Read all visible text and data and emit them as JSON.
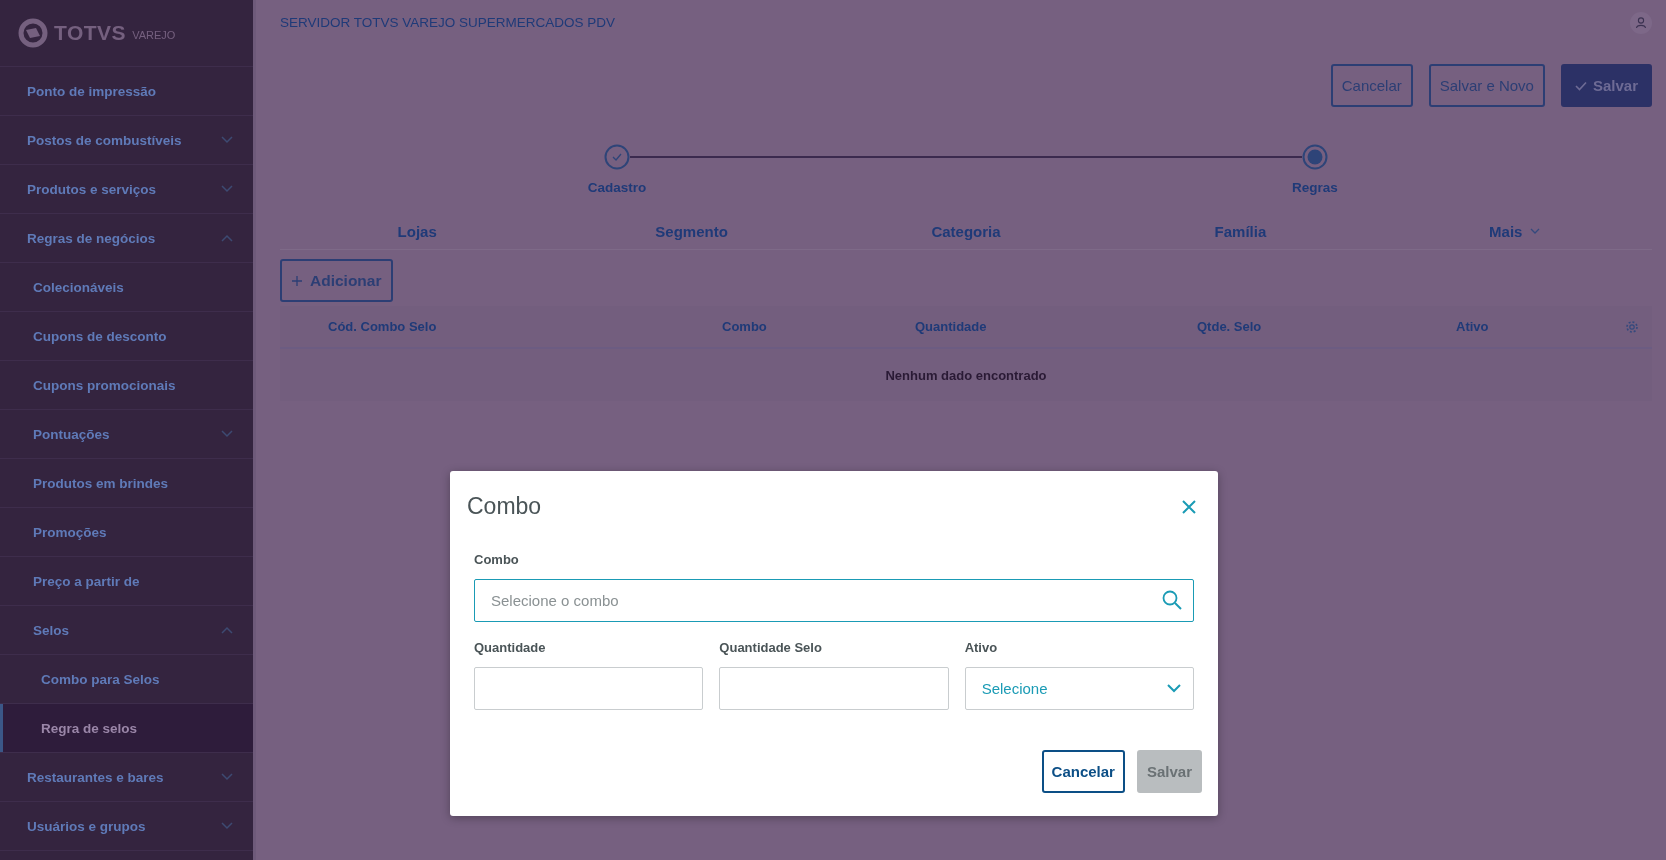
{
  "logo": {
    "brand": "TOTVS",
    "product": "VAREJO"
  },
  "sidebar": {
    "items": [
      {
        "label": "Ponto de impressão",
        "kind": "link",
        "selected": false
      },
      {
        "label": "Postos de combustíveis",
        "kind": "group",
        "expanded": false,
        "selected": false
      },
      {
        "label": "Produtos e serviços",
        "kind": "group",
        "expanded": false,
        "selected": false
      },
      {
        "label": "Regras de negócios",
        "kind": "group",
        "expanded": true,
        "selected": false,
        "children": [
          {
            "label": "Colecionáveis",
            "kind": "link",
            "selected": false
          },
          {
            "label": "Cupons de desconto",
            "kind": "link",
            "selected": false
          },
          {
            "label": "Cupons promocionais",
            "kind": "link",
            "selected": false
          },
          {
            "label": "Pontuações",
            "kind": "group",
            "expanded": false,
            "selected": false
          },
          {
            "label": "Produtos em brindes",
            "kind": "link",
            "selected": false
          },
          {
            "label": "Promoções",
            "kind": "link",
            "selected": false
          },
          {
            "label": "Preço a partir de",
            "kind": "link",
            "selected": false
          },
          {
            "label": "Selos",
            "kind": "group",
            "expanded": true,
            "selected": false,
            "children": [
              {
                "label": "Combo para Selos",
                "kind": "link",
                "selected": false
              },
              {
                "label": "Regra de selos",
                "kind": "link",
                "selected": true
              }
            ]
          }
        ]
      },
      {
        "label": "Restaurantes e bares",
        "kind": "group",
        "expanded": false,
        "selected": false
      },
      {
        "label": "Usuários e grupos",
        "kind": "group",
        "expanded": false,
        "selected": false
      }
    ]
  },
  "header": {
    "title": "SERVIDOR TOTVS VAREJO SUPERMERCADOS PDV"
  },
  "actions": [
    {
      "label": "Cancelar",
      "kind": "secondary"
    },
    {
      "label": "Salvar e Novo",
      "kind": "secondary"
    },
    {
      "label": "Salvar",
      "kind": "primary"
    }
  ],
  "stepper": {
    "steps": [
      {
        "label": "Cadastro",
        "done": true
      },
      {
        "label": "Regras",
        "done": false
      }
    ]
  },
  "tabs": [
    {
      "label": "Lojas",
      "kind": "tab"
    },
    {
      "label": "Segmento",
      "kind": "tab"
    },
    {
      "label": "Categoria",
      "kind": "tab"
    },
    {
      "label": "Família",
      "kind": "tab"
    },
    {
      "label": "Mais",
      "kind": "more"
    }
  ],
  "add_button": {
    "label": "Adicionar"
  },
  "table": {
    "columns": [
      "Cód. Combo Selo",
      "Combo",
      "Quantidade",
      "Qtde. Selo",
      "Ativo"
    ],
    "empty_message": "Nenhum dado encontrado"
  },
  "modal": {
    "title": "Combo",
    "fields": [
      {
        "kind": "search",
        "label": "Combo",
        "placeholder": "Selecione o combo"
      },
      {
        "kind": "text",
        "label": "Quantidade"
      },
      {
        "kind": "text",
        "label": "Quantidade Selo"
      },
      {
        "kind": "select",
        "label": "Ativo",
        "value": "Selecione"
      }
    ],
    "buttons": [
      {
        "label": "Cancelar",
        "disabled": false
      },
      {
        "label": "Salvar",
        "disabled": true
      }
    ]
  }
}
